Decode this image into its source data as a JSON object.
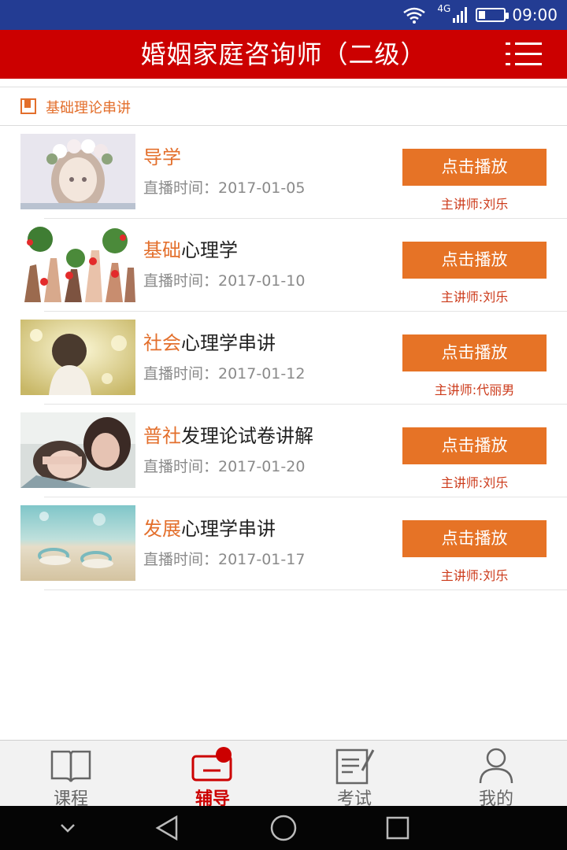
{
  "status_bar": {
    "network": "4G",
    "time": "09:00"
  },
  "app_bar": {
    "title": "婚姻家庭咨询师（二级）"
  },
  "section": {
    "label": "基础理论串讲"
  },
  "colors": {
    "accent": "#e67326",
    "brand_red": "#cc0000",
    "status_blue": "#233c93"
  },
  "courses": [
    {
      "title_highlight": "导学",
      "title_rest": "",
      "date": "直播时间：2017-01-05",
      "button": "点击播放",
      "lecturer": "主讲师:刘乐"
    },
    {
      "title_highlight": "基础",
      "title_rest": "心理学",
      "date": "直播时间：2017-01-10",
      "button": "点击播放",
      "lecturer": "主讲师:刘乐"
    },
    {
      "title_highlight": "社会",
      "title_rest": "心理学串讲",
      "date": "直播时间：2017-01-12",
      "button": "点击播放",
      "lecturer": "主讲师:代丽男"
    },
    {
      "title_highlight": "普社",
      "title_rest": "发理论试卷讲解",
      "date": "直播时间：2017-01-20",
      "button": "点击播放",
      "lecturer": "主讲师:刘乐"
    },
    {
      "title_highlight": "发展",
      "title_rest": "心理学串讲",
      "date": "直播时间：2017-01-17",
      "button": "点击播放",
      "lecturer": "主讲师:刘乐"
    }
  ],
  "tabs": [
    {
      "label": "课程",
      "icon": "book-icon",
      "active": false
    },
    {
      "label": "辅导",
      "icon": "tutoring-icon",
      "active": true
    },
    {
      "label": "考试",
      "icon": "exam-icon",
      "active": false
    },
    {
      "label": "我的",
      "icon": "user-icon",
      "active": false
    }
  ]
}
